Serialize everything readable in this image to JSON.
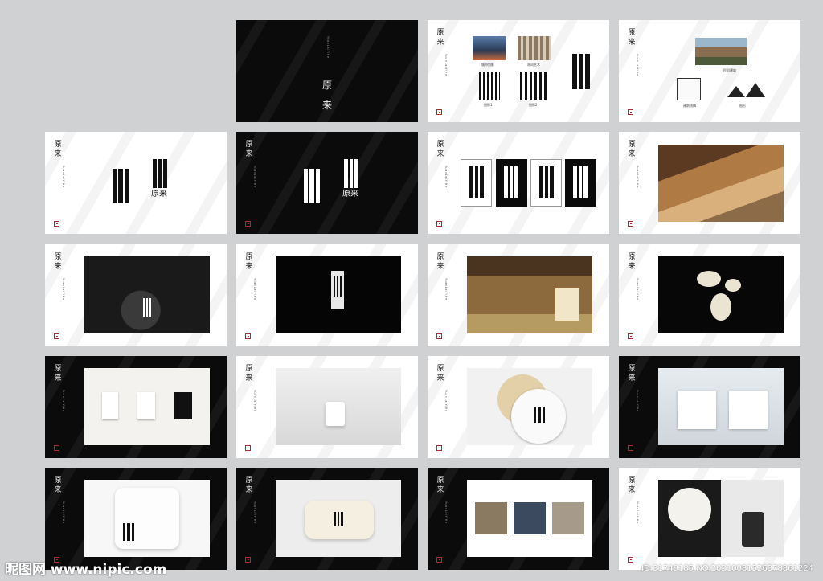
{
  "brand": {
    "char1": "原",
    "char2": "来",
    "vertical_text": "YuanLaiYiHe",
    "logo_text": "原来"
  },
  "cover": {
    "title_line1": "原",
    "title_line2": "来"
  },
  "page3": {
    "labels": [
      "城市剪影",
      "胡同艺术",
      "图形1",
      "图形2"
    ]
  },
  "page4": {
    "labels": [
      "民俗建筑",
      "建筑线稿",
      "图形"
    ]
  },
  "watermark": {
    "site": "昵图网 www.nipic.com",
    "id": "ID:31749185 NO:20210081526378861224"
  },
  "colors": {
    "dark_page": "#0b0b0b",
    "light_page": "#ffffff",
    "background": "#cfd1d2",
    "seal_red": "#b12a2a"
  }
}
